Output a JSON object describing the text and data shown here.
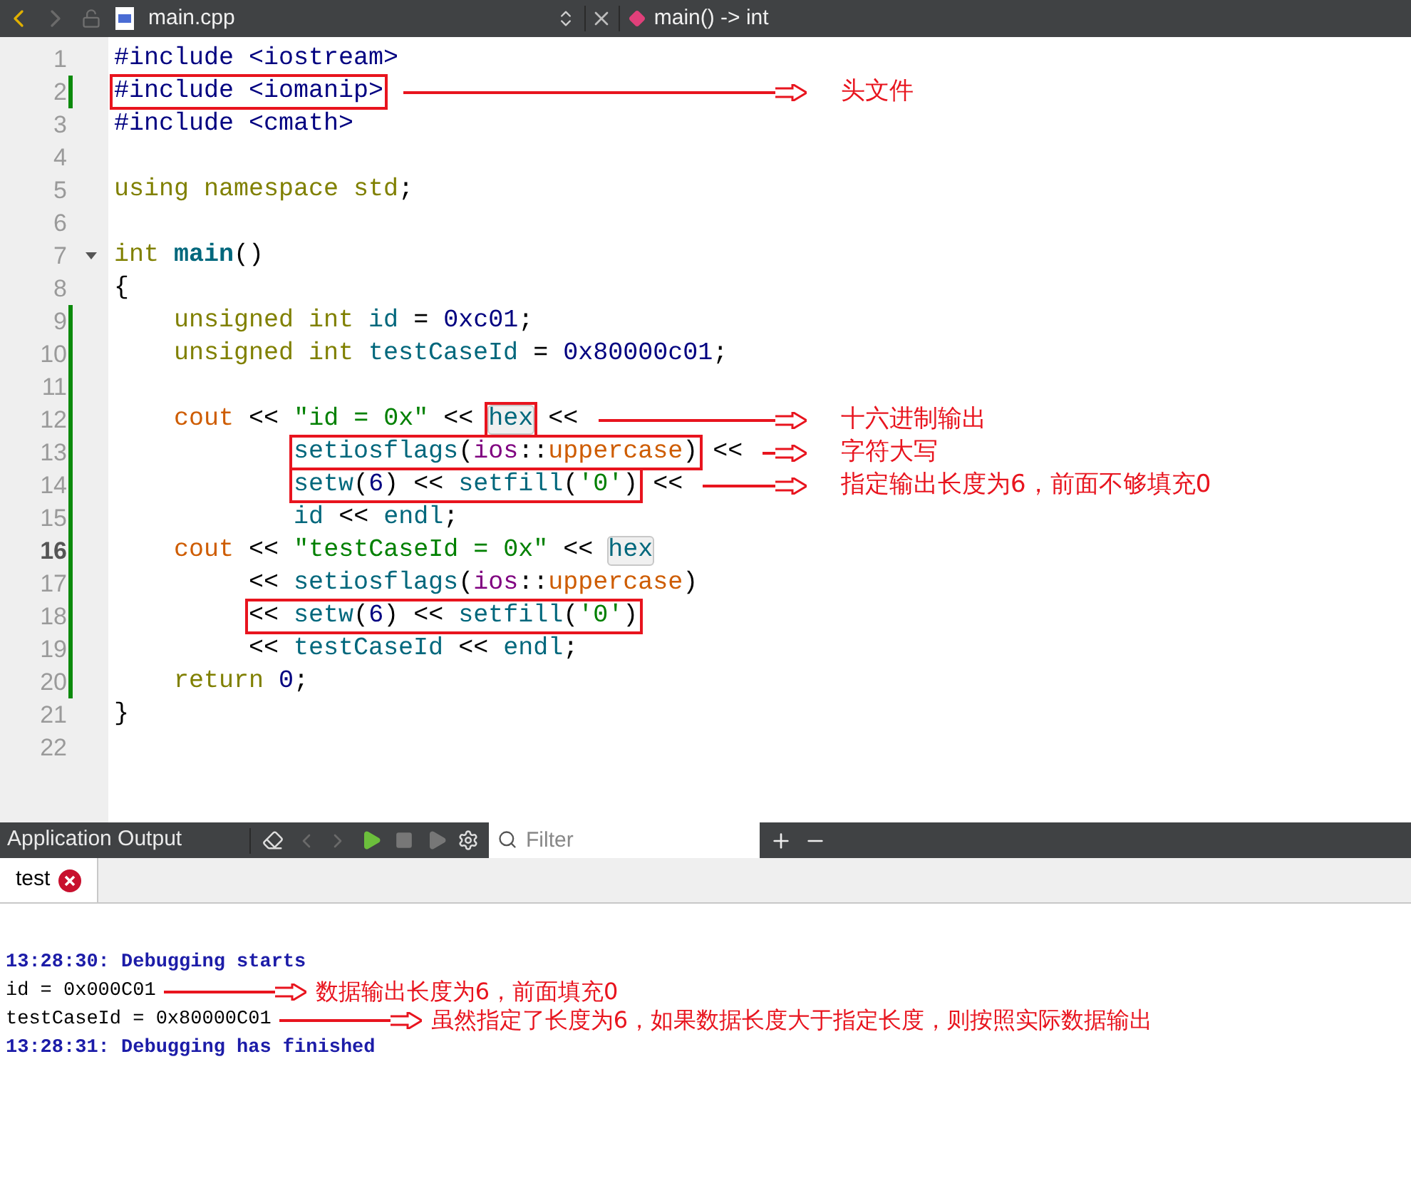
{
  "editor_toolbar": {
    "file_name": "main.cpp",
    "symbol": "main() -> int"
  },
  "code_lines": [
    {
      "number": "1",
      "modified": false,
      "current": false,
      "foldable": false,
      "tokens": [
        {
          "kind": "pp",
          "text": "#include <iostream>"
        }
      ]
    },
    {
      "number": "2",
      "modified": true,
      "current": false,
      "foldable": false,
      "tokens": [
        {
          "kind": "box",
          "tokens": [
            {
              "kind": "pp",
              "text": "#include <iomanip>"
            }
          ]
        }
      ],
      "note": "头文件"
    },
    {
      "number": "3",
      "modified": false,
      "current": false,
      "foldable": false,
      "tokens": [
        {
          "kind": "pp",
          "text": "#include <cmath>"
        }
      ]
    },
    {
      "number": "4",
      "modified": false,
      "current": false,
      "foldable": false
    },
    {
      "number": "5",
      "modified": false,
      "current": false,
      "foldable": false,
      "tokens": [
        {
          "kind": "kw",
          "text": "using namespace std"
        },
        {
          "kind": "op",
          "text": ";"
        }
      ]
    },
    {
      "number": "6",
      "modified": false,
      "current": false,
      "foldable": false
    },
    {
      "number": "7",
      "modified": false,
      "current": false,
      "foldable": true,
      "tokens": [
        {
          "kind": "kw",
          "text": "int "
        },
        {
          "kind": "fn",
          "text": "main"
        },
        {
          "kind": "op",
          "text": "()"
        }
      ]
    },
    {
      "number": "8",
      "modified": false,
      "current": false,
      "foldable": false,
      "tokens": [
        {
          "kind": "op",
          "text": "{"
        }
      ]
    },
    {
      "number": "9",
      "modified": true,
      "current": false,
      "foldable": false,
      "tokens": [
        {
          "kind": "kw",
          "text": "    unsigned int "
        },
        {
          "kind": "var",
          "text": "id"
        },
        {
          "kind": "op",
          "text": " = "
        },
        {
          "kind": "num",
          "text": "0xc01"
        },
        {
          "kind": "op",
          "text": ";"
        }
      ]
    },
    {
      "number": "10",
      "modified": true,
      "current": false,
      "foldable": false,
      "tokens": [
        {
          "kind": "kw",
          "text": "    unsigned int "
        },
        {
          "kind": "var",
          "text": "testCaseId"
        },
        {
          "kind": "op",
          "text": " = "
        },
        {
          "kind": "num",
          "text": "0x80000c01"
        },
        {
          "kind": "op",
          "text": ";"
        }
      ]
    },
    {
      "number": "11",
      "modified": true,
      "current": false,
      "foldable": false
    },
    {
      "number": "12",
      "modified": true,
      "current": false,
      "foldable": false,
      "tokens": [
        {
          "kind": "stream",
          "text": "    cout"
        },
        {
          "kind": "op",
          "text": " << "
        },
        {
          "kind": "str",
          "text": "\"id = 0x\""
        },
        {
          "kind": "op",
          "text": " << "
        },
        {
          "kind": "box",
          "tokens": [
            {
              "kind": "hl",
              "text": "hex"
            }
          ]
        },
        {
          "kind": "op",
          "text": " <<"
        }
      ],
      "note": "十六进制输出"
    },
    {
      "number": "13",
      "modified": true,
      "current": false,
      "foldable": false,
      "tokens": [
        {
          "kind": "box",
          "tokens": [
            {
              "kind": "var",
              "text": "            setiosflags"
            },
            {
              "kind": "op",
              "text": "("
            },
            {
              "kind": "ns",
              "text": "ios"
            },
            {
              "kind": "op",
              "text": "::"
            },
            {
              "kind": "stream",
              "text": "uppercase"
            },
            {
              "kind": "op",
              "text": ")"
            }
          ]
        },
        {
          "kind": "op",
          "text": " <<"
        }
      ],
      "note": "字符大写"
    },
    {
      "number": "14",
      "modified": true,
      "current": false,
      "foldable": false,
      "tokens": [
        {
          "kind": "box",
          "tokens": [
            {
              "kind": "var",
              "text": "            setw"
            },
            {
              "kind": "op",
              "text": "("
            },
            {
              "kind": "num",
              "text": "6"
            },
            {
              "kind": "op",
              "text": ") << "
            },
            {
              "kind": "var",
              "text": "setfill"
            },
            {
              "kind": "op",
              "text": "("
            },
            {
              "kind": "str",
              "text": "'0'"
            },
            {
              "kind": "op",
              "text": ")"
            }
          ]
        },
        {
          "kind": "op",
          "text": " <<"
        }
      ],
      "note": "指定输出长度为6，前面不够填充0"
    },
    {
      "number": "15",
      "modified": true,
      "current": false,
      "foldable": false,
      "tokens": [
        {
          "kind": "var",
          "text": "            id"
        },
        {
          "kind": "op",
          "text": " << "
        },
        {
          "kind": "var",
          "text": "endl"
        },
        {
          "kind": "op",
          "text": ";"
        }
      ]
    },
    {
      "number": "16",
      "modified": true,
      "current": true,
      "foldable": false,
      "tokens": [
        {
          "kind": "stream",
          "text": "    cout"
        },
        {
          "kind": "op",
          "text": " << "
        },
        {
          "kind": "str",
          "text": "\"testCaseId = 0x\""
        },
        {
          "kind": "op",
          "text": " << "
        },
        {
          "kind": "hl",
          "text": "hex"
        }
      ]
    },
    {
      "number": "17",
      "modified": true,
      "current": false,
      "foldable": false,
      "tokens": [
        {
          "kind": "op",
          "text": "         << "
        },
        {
          "kind": "var",
          "text": "setiosflags"
        },
        {
          "kind": "op",
          "text": "("
        },
        {
          "kind": "ns",
          "text": "ios"
        },
        {
          "kind": "op",
          "text": "::"
        },
        {
          "kind": "stream",
          "text": "uppercase"
        },
        {
          "kind": "op",
          "text": ")"
        }
      ]
    },
    {
      "number": "18",
      "modified": true,
      "current": false,
      "foldable": false,
      "tokens": [
        {
          "kind": "box",
          "tokens": [
            {
              "kind": "op",
              "text": "         << "
            },
            {
              "kind": "var",
              "text": "setw"
            },
            {
              "kind": "op",
              "text": "("
            },
            {
              "kind": "num",
              "text": "6"
            },
            {
              "kind": "op",
              "text": ") << "
            },
            {
              "kind": "var",
              "text": "setfill"
            },
            {
              "kind": "op",
              "text": "("
            },
            {
              "kind": "str",
              "text": "'0'"
            },
            {
              "kind": "op",
              "text": ")"
            }
          ]
        }
      ]
    },
    {
      "number": "19",
      "modified": true,
      "current": false,
      "foldable": false,
      "tokens": [
        {
          "kind": "op",
          "text": "         << "
        },
        {
          "kind": "var",
          "text": "testCaseId"
        },
        {
          "kind": "op",
          "text": " << "
        },
        {
          "kind": "var",
          "text": "endl"
        },
        {
          "kind": "op",
          "text": ";"
        }
      ]
    },
    {
      "number": "20",
      "modified": true,
      "current": false,
      "foldable": false,
      "tokens": [
        {
          "kind": "kw",
          "text": "    return "
        },
        {
          "kind": "num",
          "text": "0"
        },
        {
          "kind": "op",
          "text": ";"
        }
      ]
    },
    {
      "number": "21",
      "modified": false,
      "current": false,
      "foldable": false,
      "tokens": [
        {
          "kind": "op",
          "text": "}"
        }
      ]
    },
    {
      "number": "22",
      "modified": false,
      "current": false,
      "foldable": false
    }
  ],
  "output_panel": {
    "title": "Application Output",
    "filter_placeholder": "Filter",
    "tabs": [
      {
        "label": "test",
        "selected": true
      }
    ],
    "lines": [
      {
        "kind": "info",
        "text": "13:28:30: Debugging starts"
      },
      {
        "kind": "stdout",
        "text": "id = 0x000C01",
        "note": "数据输出长度为6，前面填充0"
      },
      {
        "kind": "stdout",
        "text": "testCaseId = 0x80000C01",
        "note": "虽然指定了长度为6，如果数据长度大于指定长度，则按照实际数据输出"
      },
      {
        "kind": "info",
        "text": "13:28:31: Debugging has finished"
      }
    ]
  }
}
